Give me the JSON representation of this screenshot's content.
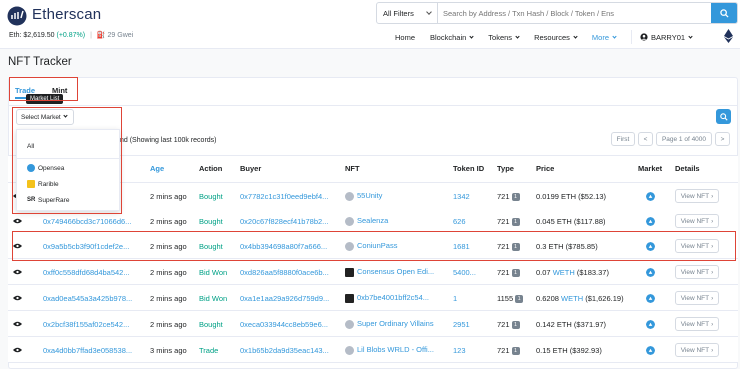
{
  "brand": {
    "name": "Etherscan"
  },
  "ticker": {
    "eth_label": "Eth: $2,619.50",
    "eth_change": "(+0.87%)",
    "gas": "29 Gwei"
  },
  "search": {
    "filter": "All Filters",
    "placeholder": "Search by Address / Txn Hash / Block / Token / Ens"
  },
  "nav": {
    "items": [
      "Home",
      "Blockchain",
      "Tokens",
      "Resources",
      "More"
    ],
    "user": "BARRY01"
  },
  "page": {
    "title": "NFT Tracker"
  },
  "tabs": {
    "trade": "Trade",
    "mint": "Mint"
  },
  "tooltip": "Market List",
  "select_market": {
    "label": "Select Market",
    "options": [
      "All",
      "Opensea",
      "Rarible",
      "SuperRare"
    ]
  },
  "records_text": "nd (Showing last 100k records)",
  "pager": {
    "first": "First",
    "prev": "<",
    "page": "Page 1 of 4000",
    "next": ">",
    "last": "Last"
  },
  "table": {
    "headers": [
      "Age",
      "Action",
      "Buyer",
      "NFT",
      "Token ID",
      "Type",
      "Price",
      "Market",
      "Details"
    ],
    "view_label": "View NFT",
    "rows": [
      {
        "txn": "0x...",
        "age": "2 mins ago",
        "action": "Bought",
        "buyer": "0x7782c1c31f0eed9ebf4...",
        "nft": "55Unity",
        "token_id": "1342",
        "type": "721",
        "qty": "1",
        "price": "0.0199 ETH ($52.13)"
      },
      {
        "txn": "0x749466bcd3c71066d6...",
        "age": "2 mins ago",
        "action": "Bought",
        "buyer": "0x20c67f828ecf41b78b2...",
        "nft": "Sealenza",
        "token_id": "626",
        "type": "721",
        "qty": "1",
        "price": "0.045 ETH ($117.88)"
      },
      {
        "txn": "0x9a5b5cb3f90f1cdef2e...",
        "age": "2 mins ago",
        "action": "Bought",
        "buyer": "0x4bb394698a80f7a666...",
        "nft": "ConiunPass",
        "token_id": "1681",
        "type": "721",
        "qty": "1",
        "price": "0.3 ETH ($785.85)"
      },
      {
        "txn": "0xff0c558dfd68d4ba542...",
        "age": "2 mins ago",
        "action": "Bid Won",
        "buyer": "0xd826aa5f8880f0ace6b...",
        "nft": "Consensus Open Edi...",
        "token_id": "5400...",
        "type": "721",
        "qty": "1",
        "price_pre": "0.07 ",
        "price_link": "WETH",
        "price_post": " ($183.37)"
      },
      {
        "txn": "0xad0ea545a3a425b978...",
        "age": "2 mins ago",
        "action": "Bid Won",
        "buyer": "0xa1e1aa29a926d759d9...",
        "nft": "0xb7be4001bff2c54...",
        "token_id": "1",
        "type": "1155",
        "qty": "1",
        "price_pre": "0.6208 ",
        "price_link": "WETH",
        "price_post": " ($1,626.19)"
      },
      {
        "txn": "0x2bcf38f155af02ce542...",
        "age": "2 mins ago",
        "action": "Bought",
        "buyer": "0xeca033944cc8eb59e6...",
        "nft": "Super Ordinary Villains",
        "token_id": "2951",
        "type": "721",
        "qty": "1",
        "price": "0.142 ETH ($371.97)"
      },
      {
        "txn": "0xa4d0bb7ffad3e058538...",
        "age": "3 mins ago",
        "action": "Trade",
        "buyer": "0x1b65b2da9d35eac143...",
        "nft": "Lil Blobs WRLD - Offi...",
        "token_id": "123",
        "type": "721",
        "qty": "1",
        "price": "0.15 ETH ($392.93)"
      }
    ]
  },
  "colors": {
    "accent": "#3498db",
    "success": "#00a186",
    "highlight": "#de4437"
  }
}
